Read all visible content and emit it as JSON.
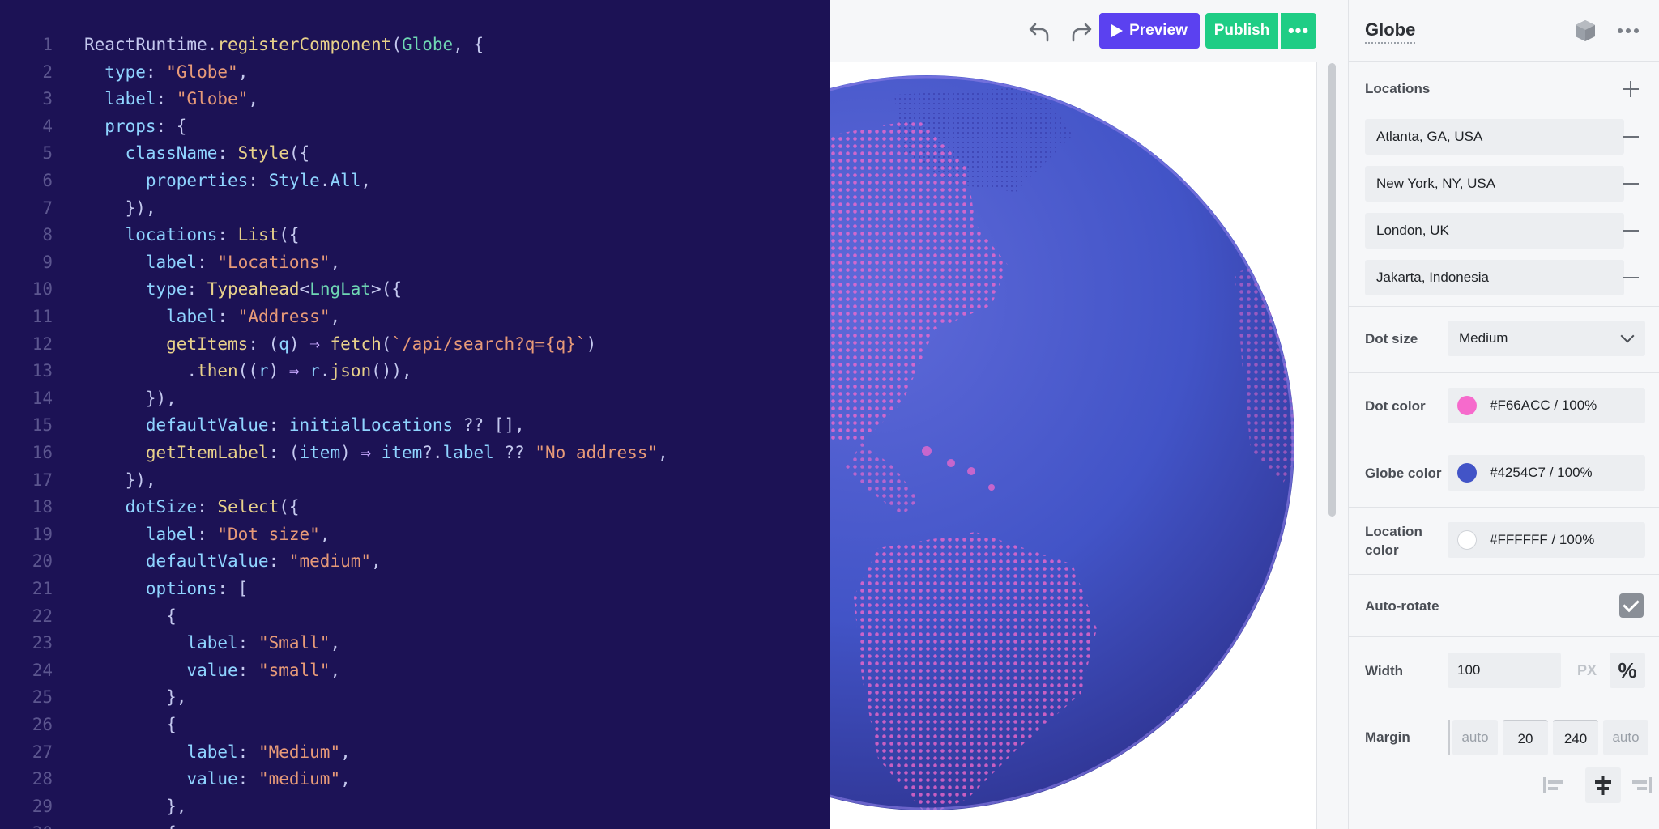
{
  "code": {
    "lines": [
      [
        [
          "ReactRuntime",
          "p"
        ],
        [
          ".",
          "p"
        ],
        [
          "registerComponent",
          "fn"
        ],
        [
          "(",
          "p"
        ],
        [
          "Globe",
          "type"
        ],
        [
          ", {",
          "p"
        ]
      ],
      [
        [
          "  ",
          "p"
        ],
        [
          "type",
          "prop"
        ],
        [
          ": ",
          "p"
        ],
        [
          "\"Globe\"",
          "str"
        ],
        [
          ",",
          "p"
        ]
      ],
      [
        [
          "  ",
          "p"
        ],
        [
          "label",
          "prop"
        ],
        [
          ": ",
          "p"
        ],
        [
          "\"Globe\"",
          "str"
        ],
        [
          ",",
          "p"
        ]
      ],
      [
        [
          "  ",
          "p"
        ],
        [
          "props",
          "prop"
        ],
        [
          ": {",
          "p"
        ]
      ],
      [
        [
          "    ",
          "p"
        ],
        [
          "className",
          "prop"
        ],
        [
          ": ",
          "p"
        ],
        [
          "Style",
          "fn"
        ],
        [
          "({",
          "p"
        ]
      ],
      [
        [
          "      ",
          "p"
        ],
        [
          "properties",
          "prop"
        ],
        [
          ": ",
          "p"
        ],
        [
          "Style",
          "prop"
        ],
        [
          ".",
          "p"
        ],
        [
          "All",
          "prop"
        ],
        [
          ",",
          "p"
        ]
      ],
      [
        [
          "    ",
          "p"
        ],
        [
          "}),",
          "p"
        ]
      ],
      [
        [
          "    ",
          "p"
        ],
        [
          "locations",
          "prop"
        ],
        [
          ": ",
          "p"
        ],
        [
          "List",
          "fn"
        ],
        [
          "({",
          "p"
        ]
      ],
      [
        [
          "      ",
          "p"
        ],
        [
          "label",
          "prop"
        ],
        [
          ": ",
          "p"
        ],
        [
          "\"Locations\"",
          "str"
        ],
        [
          ",",
          "p"
        ]
      ],
      [
        [
          "      ",
          "p"
        ],
        [
          "type",
          "prop"
        ],
        [
          ": ",
          "p"
        ],
        [
          "Typeahead",
          "fn"
        ],
        [
          "<",
          "p"
        ],
        [
          "LngLat",
          "type"
        ],
        [
          ">({",
          "p"
        ]
      ],
      [
        [
          "        ",
          "p"
        ],
        [
          "label",
          "prop"
        ],
        [
          ": ",
          "p"
        ],
        [
          "\"Address\"",
          "str"
        ],
        [
          ",",
          "p"
        ]
      ],
      [
        [
          "        ",
          "p"
        ],
        [
          "getItems",
          "fn"
        ],
        [
          ": (",
          "p"
        ],
        [
          "q",
          "prop"
        ],
        [
          ") ",
          "p"
        ],
        [
          "⇒",
          "op"
        ],
        [
          " ",
          "p"
        ],
        [
          "fetch",
          "fn"
        ],
        [
          "(",
          "p"
        ],
        [
          "`/api/search?q={q}`",
          "str"
        ],
        [
          ")",
          "p"
        ]
      ],
      [
        [
          "          ",
          "p"
        ],
        [
          ".",
          "p"
        ],
        [
          "then",
          "fn"
        ],
        [
          "((",
          "p"
        ],
        [
          "r",
          "prop"
        ],
        [
          ") ",
          "p"
        ],
        [
          "⇒",
          "op"
        ],
        [
          " ",
          "p"
        ],
        [
          "r",
          "prop"
        ],
        [
          ".",
          "p"
        ],
        [
          "json",
          "fn"
        ],
        [
          "()),",
          "p"
        ]
      ],
      [
        [
          "      ",
          "p"
        ],
        [
          "}),",
          "p"
        ]
      ],
      [
        [
          "      ",
          "p"
        ],
        [
          "defaultValue",
          "prop"
        ],
        [
          ": ",
          "p"
        ],
        [
          "initialLocations",
          "prop"
        ],
        [
          " ?? [],",
          "p"
        ]
      ],
      [
        [
          "      ",
          "p"
        ],
        [
          "getItemLabel",
          "fn"
        ],
        [
          ": (",
          "p"
        ],
        [
          "item",
          "prop"
        ],
        [
          ") ",
          "p"
        ],
        [
          "⇒",
          "op"
        ],
        [
          " ",
          "p"
        ],
        [
          "item",
          "prop"
        ],
        [
          "?.",
          "p"
        ],
        [
          "label",
          "prop"
        ],
        [
          " ?? ",
          "p"
        ],
        [
          "\"No address\"",
          "str"
        ],
        [
          ",",
          "p"
        ]
      ],
      [
        [
          "    ",
          "p"
        ],
        [
          "}),",
          "p"
        ]
      ],
      [
        [
          "    ",
          "p"
        ],
        [
          "dotSize",
          "prop"
        ],
        [
          ": ",
          "p"
        ],
        [
          "Select",
          "fn"
        ],
        [
          "({",
          "p"
        ]
      ],
      [
        [
          "      ",
          "p"
        ],
        [
          "label",
          "prop"
        ],
        [
          ": ",
          "p"
        ],
        [
          "\"Dot size\"",
          "str"
        ],
        [
          ",",
          "p"
        ]
      ],
      [
        [
          "      ",
          "p"
        ],
        [
          "defaultValue",
          "prop"
        ],
        [
          ": ",
          "p"
        ],
        [
          "\"medium\"",
          "str"
        ],
        [
          ",",
          "p"
        ]
      ],
      [
        [
          "      ",
          "p"
        ],
        [
          "options",
          "prop"
        ],
        [
          ": [",
          "p"
        ]
      ],
      [
        [
          "        ",
          "p"
        ],
        [
          "{",
          "p"
        ]
      ],
      [
        [
          "          ",
          "p"
        ],
        [
          "label",
          "prop"
        ],
        [
          ": ",
          "p"
        ],
        [
          "\"Small\"",
          "str"
        ],
        [
          ",",
          "p"
        ]
      ],
      [
        [
          "          ",
          "p"
        ],
        [
          "value",
          "prop"
        ],
        [
          ": ",
          "p"
        ],
        [
          "\"small\"",
          "str"
        ],
        [
          ",",
          "p"
        ]
      ],
      [
        [
          "        ",
          "p"
        ],
        [
          "},",
          "p"
        ]
      ],
      [
        [
          "        ",
          "p"
        ],
        [
          "{",
          "p"
        ]
      ],
      [
        [
          "          ",
          "p"
        ],
        [
          "label",
          "prop"
        ],
        [
          ": ",
          "p"
        ],
        [
          "\"Medium\"",
          "str"
        ],
        [
          ",",
          "p"
        ]
      ],
      [
        [
          "          ",
          "p"
        ],
        [
          "value",
          "prop"
        ],
        [
          ": ",
          "p"
        ],
        [
          "\"medium\"",
          "str"
        ],
        [
          ",",
          "p"
        ]
      ],
      [
        [
          "        ",
          "p"
        ],
        [
          "},",
          "p"
        ]
      ],
      [
        [
          "        ",
          "p"
        ],
        [
          "{",
          "p"
        ]
      ]
    ]
  },
  "toolbar": {
    "undo_icon": "undo-icon",
    "redo_icon": "redo-icon",
    "preview_label": "Preview",
    "publish_label": "Publish",
    "more_label": "•••"
  },
  "preview": {
    "globe_color": "#4254C7",
    "dot_color": "#F66ACC"
  },
  "inspector": {
    "title": "Globe",
    "locations_label": "Locations",
    "locations": [
      "Atlanta, GA, USA",
      "New York, NY, USA",
      "London, UK",
      "Jakarta, Indonesia"
    ],
    "dot_size": {
      "label": "Dot size",
      "value": "Medium"
    },
    "dot_color": {
      "label": "Dot color",
      "value": "#F66ACC / 100%",
      "swatch": "#F66ACC"
    },
    "globe_color": {
      "label": "Globe color",
      "value": "#4254C7 / 100%",
      "swatch": "#4254C7"
    },
    "location_color": {
      "label": "Location color",
      "value": "#FFFFFF / 100%",
      "swatch": "#FFFFFF"
    },
    "auto_rotate": {
      "label": "Auto-rotate",
      "checked": true
    },
    "width": {
      "label": "Width",
      "value": "100",
      "unit_px": "PX",
      "unit_pct": "%"
    },
    "margin": {
      "label": "Margin",
      "left": "auto",
      "top": "20",
      "bottom": "240",
      "right": "auto"
    }
  }
}
